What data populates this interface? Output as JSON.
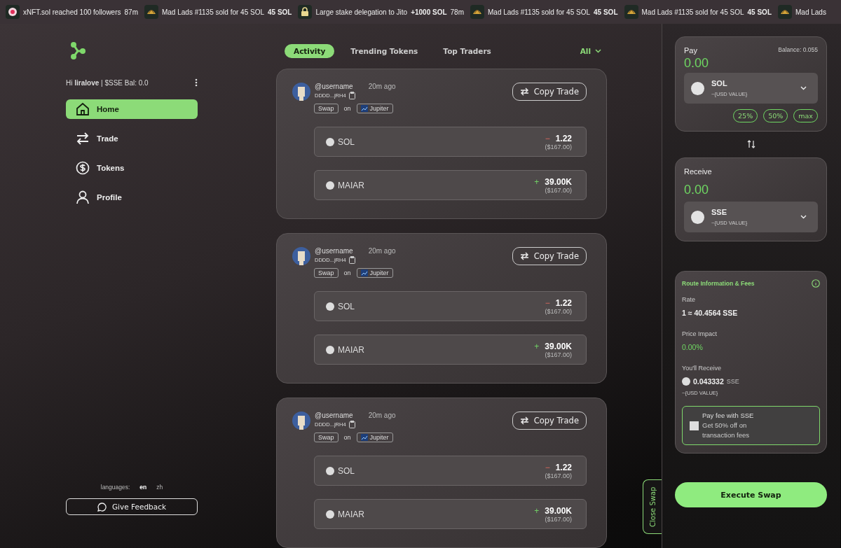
{
  "ticker": [
    {
      "kind": "user",
      "text": "xNFT.sol reached 100 followers",
      "time": "87m"
    },
    {
      "kind": "nft",
      "text": "Mad Lads #1135 sold for 45 SOL",
      "amount": "45 SOL"
    },
    {
      "kind": "lock",
      "text": "Large stake delegation to Jito",
      "amount": "+1000 SOL",
      "time": "78m"
    },
    {
      "kind": "nft",
      "text": "Mad Lads #1135 sold for 45 SOL",
      "amount": "45  SOL"
    },
    {
      "kind": "nft",
      "text": "Mad Lads #1135 sold for 45 SOL",
      "amount": "45  SOL"
    },
    {
      "kind": "nft",
      "text": "Mad Lads"
    }
  ],
  "sidebar": {
    "greeting": "Hi **liralove** | $SSE Bal: 0.0",
    "items": [
      {
        "label": "Home",
        "selected": true
      },
      {
        "label": "Trade",
        "selected": false
      },
      {
        "label": "Tokens",
        "selected": false
      },
      {
        "label": "Profile",
        "selected": false
      }
    ],
    "languages_label": "languages:",
    "languages": [
      {
        "label": "en",
        "selected": true
      },
      {
        "label": "zh",
        "selected": false
      }
    ],
    "feedback_button": "Give Feedback"
  },
  "feed": {
    "tabs": [
      {
        "label": "Activity",
        "selected": true
      },
      {
        "label": "Trending Tokens",
        "selected": false
      },
      {
        "label": "Top Traders",
        "selected": false
      }
    ],
    "filter": "All",
    "cards": [
      {
        "user": "@username",
        "time": "20m ago",
        "address": "DDDD...jRH4",
        "action": "Swap",
        "on": "on",
        "dex": "Jupiter",
        "copy_button": "Copy Trade",
        "legs": [
          {
            "token": "SOL",
            "kind": "sell",
            "sign": "−",
            "amount": "1.22",
            "usd": "($167.00)"
          },
          {
            "token": "MAIAR",
            "kind": "buy",
            "sign": "+",
            "amount": "39.00K",
            "usd": "($167.00)"
          }
        ]
      },
      {
        "user": "@username",
        "time": "20m ago",
        "address": "DDDD...jRH4",
        "action": "Swap",
        "on": "on",
        "dex": "Jupiter",
        "copy_button": "Copy Trade",
        "legs": [
          {
            "token": "SOL",
            "kind": "sell",
            "sign": "−",
            "amount": "1.22",
            "usd": "($167.00)"
          },
          {
            "token": "MAIAR",
            "kind": "buy",
            "sign": "+",
            "amount": "39.00K",
            "usd": "($167.00)"
          }
        ]
      },
      {
        "user": "@username",
        "time": "20m ago",
        "address": "DDDD...jRH4",
        "action": "Swap",
        "on": "on",
        "dex": "Jupiter",
        "copy_button": "Copy Trade",
        "legs": [
          {
            "token": "SOL",
            "kind": "sell",
            "sign": "−",
            "amount": "1.22",
            "usd": "($167.00)"
          },
          {
            "token": "MAIAR",
            "kind": "buy",
            "sign": "+",
            "amount": "39.00K",
            "usd": "($167.00)"
          }
        ]
      }
    ]
  },
  "close_swap": "Close Swap",
  "swap": {
    "pay": {
      "label": "Pay",
      "balance": "Balance: 0.055",
      "amount": "0.00",
      "token": "SOL",
      "usd": "~{USD VALUE}",
      "presets": [
        "25%",
        "50%",
        "max"
      ]
    },
    "receive": {
      "label": "Receive",
      "amount": "0.00",
      "token": "SSE",
      "usd": "~{USD VALUE}"
    },
    "route": {
      "title": "Route Information & Fees",
      "rate_label": "Rate",
      "rate": "1 ≈ 40.4564 SSE",
      "impact_label": "Price Impact",
      "impact": "0.00%",
      "receive_label": "You'll Receive",
      "receive_amount": "0.043332",
      "receive_token": "SSE",
      "receive_usd": "~{USD VALUE}",
      "fee_option": {
        "checked": false,
        "title": "Pay fee with SSE",
        "text": "Get 50% off on transaction fees"
      }
    },
    "execute_button": "Execute Swap"
  }
}
